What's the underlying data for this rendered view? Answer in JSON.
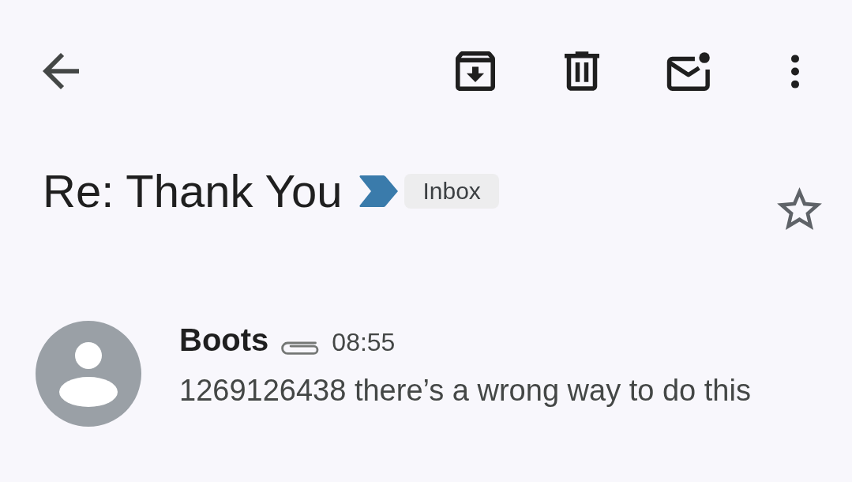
{
  "subject": {
    "title": "Re: Thank You",
    "important": true,
    "label": "Inbox",
    "starred": false
  },
  "messages": [
    {
      "sender": "Boots",
      "has_attachment": true,
      "time": "08:55",
      "snippet": "1269126438 there’s a wrong way to do this"
    }
  ]
}
